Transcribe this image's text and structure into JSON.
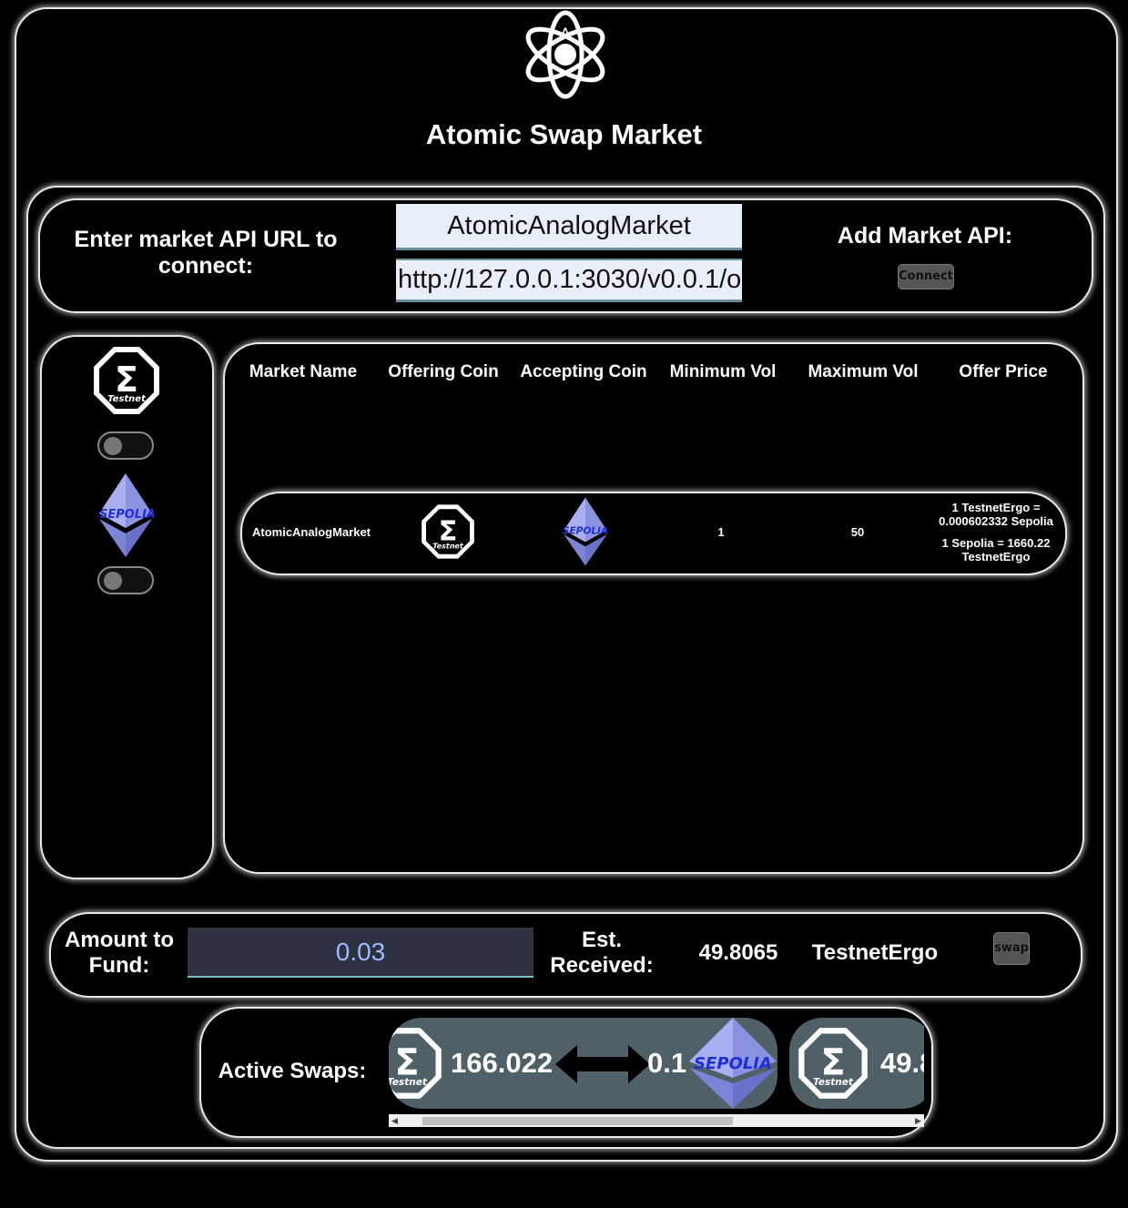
{
  "header": {
    "title": "Atomic Swap Market",
    "logo_letter": "A"
  },
  "connect": {
    "prompt": "Enter market API URL to connect:",
    "name_value": "AtomicAnalogMarket",
    "url_value": "http://127.0.0.1:3030/v0.0.1/o",
    "add_label": "Add Market API:",
    "connect_label": "Connect"
  },
  "coins": {
    "ergo_caption": "Testnet",
    "eth_caption": "SEPOLIA",
    "ergo_toggle_on": false,
    "eth_toggle_on": false
  },
  "table": {
    "headers": [
      "Market Name",
      "Offering Coin",
      "Accepting Coin",
      "Minimum Vol",
      "Maximum Vol",
      "Offer Price"
    ],
    "rows": [
      {
        "market_name": "AtomicAnalogMarket",
        "offering_coin": "Testnet",
        "accepting_coin": "SEPOLIA",
        "min_vol": "1",
        "max_vol": "50",
        "price_line1": "1 TestnetErgo = 0.000602332 Sepolia",
        "price_line2": "1 Sepolia = 1660.22 TestnetErgo"
      }
    ]
  },
  "fund": {
    "amount_label": "Amount to Fund:",
    "amount_value": "0.03",
    "est_label": "Est. Received:",
    "est_value": "49.8065",
    "est_coin": "TestnetErgo",
    "swap_label": "swap"
  },
  "active_swaps": {
    "label": "Active Swaps:",
    "swaps": [
      {
        "from_amount": "166.022",
        "to_amount": "0.1",
        "from_caption": "Testnet",
        "to_caption": "SEPOLIA"
      },
      {
        "from_amount": "49.8",
        "from_caption": "Testnet"
      }
    ],
    "scroll_position_fraction": 0.06
  },
  "colors": {
    "background": "#000000",
    "panel_border": "#e8e8e8",
    "input_bg": "#e9eefb",
    "amount_bg": "#2e3140",
    "swap_card_bg": "#4f6068",
    "eth_purple": "#7d84d8",
    "sepolia_text": "#1f2fd8"
  }
}
